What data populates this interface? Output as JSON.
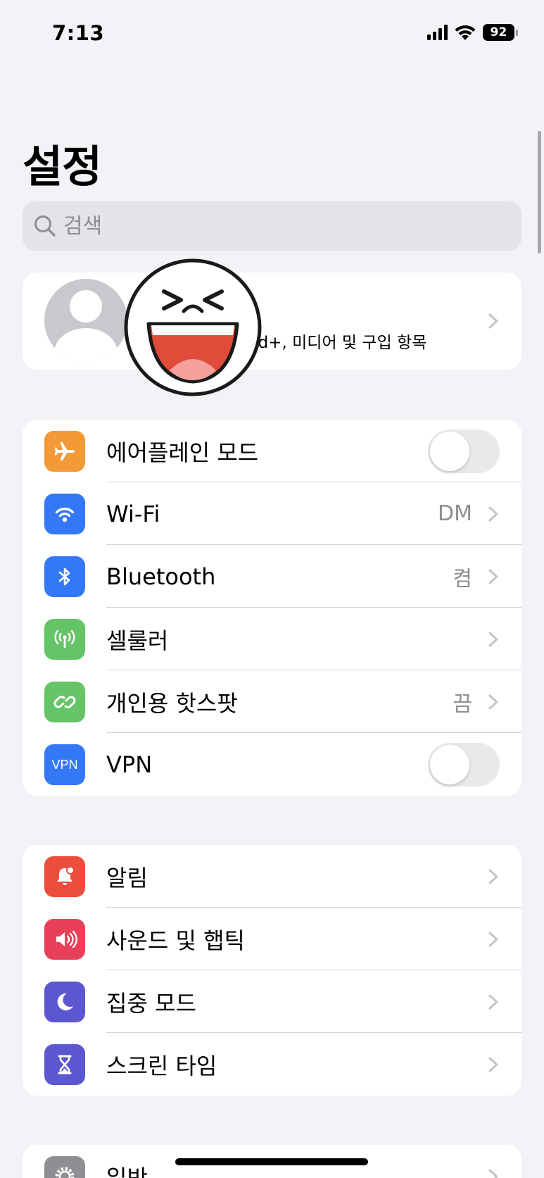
{
  "status_bar": {
    "time": "7:13",
    "battery": "92"
  },
  "page_title": "설정",
  "search": {
    "placeholder": "검색"
  },
  "profile": {
    "subtitle": "oud+, 미디어 및 구입 항목"
  },
  "network_group": [
    {
      "label": "에어플레인 모드",
      "icon": "airplane-icon",
      "color": "#f19a37",
      "control": "toggle",
      "on": false
    },
    {
      "label": "Wi-Fi",
      "icon": "wifi-icon",
      "color": "#3478f6",
      "value": "DM",
      "control": "chevron"
    },
    {
      "label": "Bluetooth",
      "icon": "bluetooth-icon",
      "color": "#3478f6",
      "value": "켬",
      "control": "chevron"
    },
    {
      "label": "셀룰러",
      "icon": "cellular-icon",
      "color": "#65c466",
      "control": "chevron"
    },
    {
      "label": "개인용 핫스팟",
      "icon": "hotspot-icon",
      "color": "#65c466",
      "value": "끔",
      "control": "chevron"
    },
    {
      "label": "VPN",
      "icon": "vpn-icon",
      "icon_text": "VPN",
      "color": "#3478f6",
      "control": "toggle",
      "on": false
    }
  ],
  "notification_group": [
    {
      "label": "알림",
      "icon": "notification-bell-icon",
      "color": "#eb4e3d"
    },
    {
      "label": "사운드 및 햅틱",
      "icon": "speaker-icon",
      "color": "#e9405a"
    },
    {
      "label": "집중 모드",
      "icon": "moon-icon",
      "color": "#5b57cf"
    },
    {
      "label": "스크린 타임",
      "icon": "hourglass-icon",
      "color": "#5b57cf"
    }
  ],
  "general_group": [
    {
      "label": "일반",
      "icon": "gear-icon",
      "color": "#8e8e93"
    }
  ]
}
